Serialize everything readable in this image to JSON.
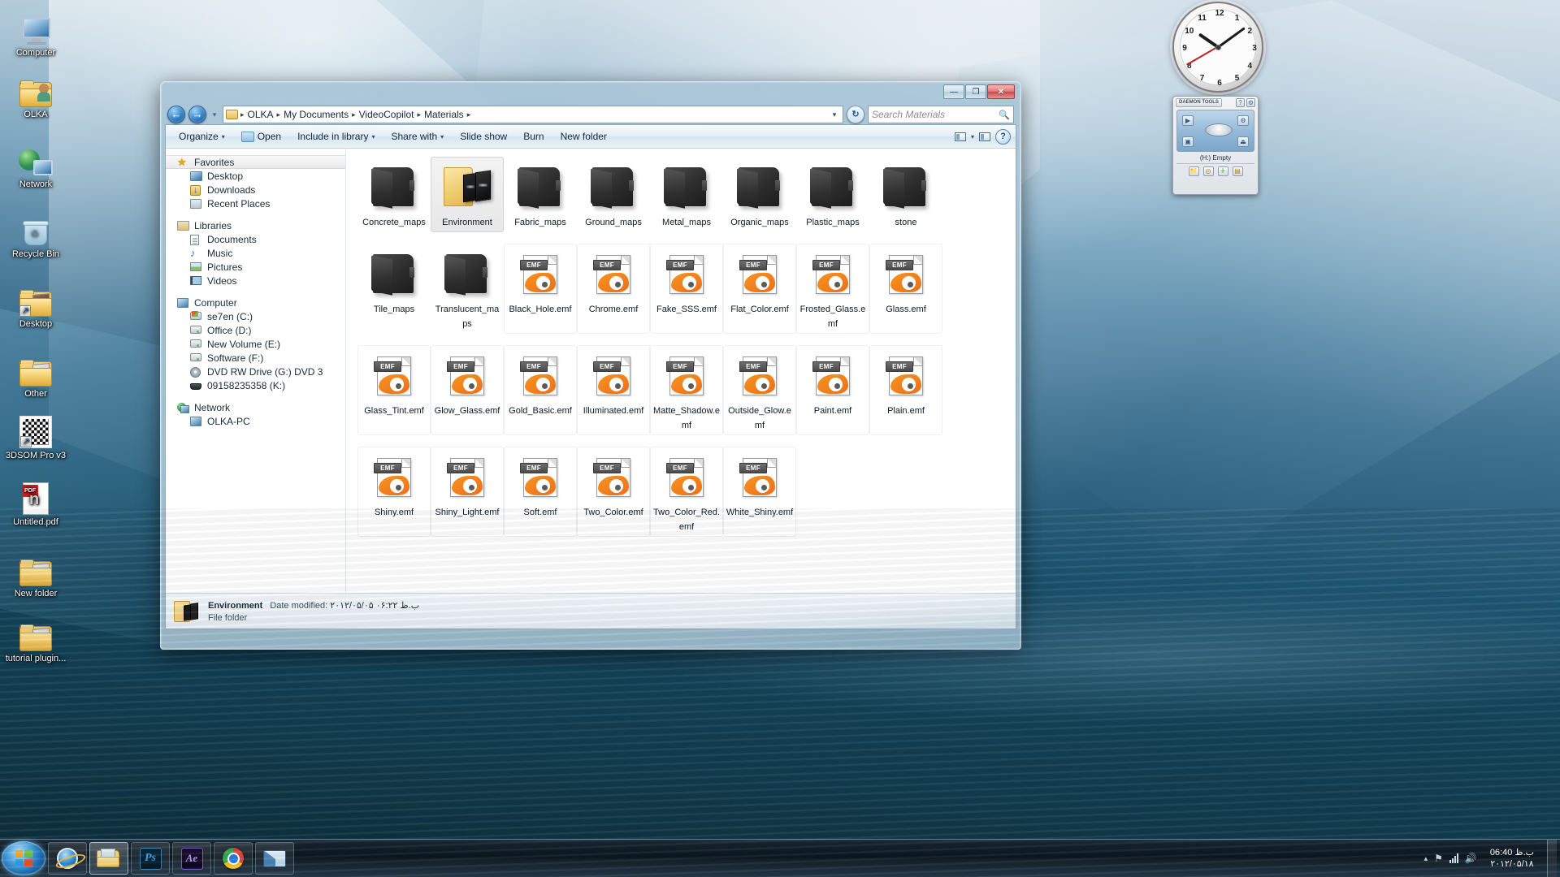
{
  "desktop": {
    "icons": [
      {
        "label": "Computer",
        "icon": "computer-icon"
      },
      {
        "label": "OLKA",
        "icon": "user-folder-icon"
      },
      {
        "label": "Network",
        "icon": "network-icon"
      },
      {
        "label": "Recycle Bin",
        "icon": "recycle-bin-icon"
      },
      {
        "label": "Desktop",
        "icon": "desktop-folder-shortcut-icon"
      },
      {
        "label": "Other",
        "icon": "folder-shortcut-icon"
      },
      {
        "label": "3DSOM Pro v3",
        "icon": "3dsom-shortcut-icon"
      },
      {
        "label": "Untitled.pdf",
        "icon": "pdf-file-icon"
      },
      {
        "label": "New folder",
        "icon": "folder-icon"
      },
      {
        "label": "tutorial plugin...",
        "icon": "folder-icon"
      }
    ]
  },
  "clock_gadget": {
    "name": "analog-clock",
    "hour": 10,
    "minute": 9,
    "second": 40,
    "numbers": [
      "12",
      "1",
      "2",
      "3",
      "4",
      "5",
      "6",
      "7",
      "8",
      "9",
      "10",
      "11"
    ]
  },
  "daemon_gadget": {
    "title": "DAEMON TOOLS",
    "help_label": "?",
    "options_label": "⚙",
    "drive_status": "(H:) Empty",
    "buttons": [
      "mount",
      "eject",
      "settings"
    ],
    "tray_buttons": [
      "📁",
      "💿",
      "＋",
      "🖫"
    ]
  },
  "window": {
    "controls": {
      "minimize": "—",
      "maximize": "❐",
      "close": "✕"
    },
    "nav": {
      "back": "←",
      "forward": "→",
      "history_caret": "▾"
    },
    "breadcrumb": {
      "items": [
        "OLKA",
        "My Documents",
        "VideoCopilot",
        "Materials"
      ],
      "separator": "▸",
      "dropdown": "▾",
      "refresh": "↻"
    },
    "search": {
      "placeholder": "Search Materials",
      "icon": "search-icon"
    },
    "commandbar": {
      "items": [
        {
          "label": "Organize",
          "caret": "▾",
          "icon": null
        },
        {
          "label": "Open",
          "caret": null,
          "icon": "open-folder-icon"
        },
        {
          "label": "Include in library",
          "caret": "▾",
          "icon": null
        },
        {
          "label": "Share with",
          "caret": "▾",
          "icon": null
        },
        {
          "label": "Slide show",
          "caret": null,
          "icon": null
        },
        {
          "label": "Burn",
          "caret": null,
          "icon": null
        },
        {
          "label": "New folder",
          "caret": null,
          "icon": null
        }
      ],
      "view_caret": "▾",
      "help_label": "?"
    },
    "navpane": {
      "groups": [
        {
          "header": {
            "label": "Favorites",
            "icon": "star-icon",
            "selected": true
          },
          "children": [
            {
              "label": "Desktop",
              "icon": "desktop-icon"
            },
            {
              "label": "Downloads",
              "icon": "downloads-icon"
            },
            {
              "label": "Recent Places",
              "icon": "recent-places-icon"
            }
          ]
        },
        {
          "header": {
            "label": "Libraries",
            "icon": "libraries-icon",
            "selected": false
          },
          "children": [
            {
              "label": "Documents",
              "icon": "document-icon"
            },
            {
              "label": "Music",
              "icon": "music-icon"
            },
            {
              "label": "Pictures",
              "icon": "pictures-icon"
            },
            {
              "label": "Videos",
              "icon": "videos-icon"
            }
          ]
        },
        {
          "header": {
            "label": "Computer",
            "icon": "computer-icon",
            "selected": false
          },
          "children": [
            {
              "label": "se7en (C:)",
              "icon": "system-drive-icon"
            },
            {
              "label": "Office (D:)",
              "icon": "drive-icon"
            },
            {
              "label": "New Volume (E:)",
              "icon": "drive-icon"
            },
            {
              "label": "Software (F:)",
              "icon": "drive-icon"
            },
            {
              "label": "DVD RW Drive (G:) DVD 3",
              "icon": "dvd-drive-icon"
            },
            {
              "label": "09158235358 (K:)",
              "icon": "portable-device-icon"
            }
          ]
        },
        {
          "header": {
            "label": "Network",
            "icon": "network-icon",
            "selected": false
          },
          "children": [
            {
              "label": "OLKA-PC",
              "icon": "computer-icon"
            }
          ]
        }
      ]
    },
    "files": [
      {
        "name": "Concrete_maps",
        "type": "folder-dark",
        "selected": false
      },
      {
        "name": "Environment",
        "type": "folder-thumb",
        "selected": true
      },
      {
        "name": "Fabric_maps",
        "type": "folder-dark",
        "selected": false
      },
      {
        "name": "Ground_maps",
        "type": "folder-dark",
        "selected": false
      },
      {
        "name": "Metal_maps",
        "type": "folder-dark",
        "selected": false
      },
      {
        "name": "Organic_maps",
        "type": "folder-dark",
        "selected": false
      },
      {
        "name": "Plastic_maps",
        "type": "folder-dark",
        "selected": false
      },
      {
        "name": "stone",
        "type": "folder-dark",
        "selected": false
      },
      {
        "name": "Tile_maps",
        "type": "folder-dark",
        "selected": false
      },
      {
        "name": "Translucent_maps",
        "type": "folder-dark",
        "selected": false
      },
      {
        "name": "Black_Hole.emf",
        "type": "emf",
        "selected": false
      },
      {
        "name": "Chrome.emf",
        "type": "emf",
        "selected": false
      },
      {
        "name": "Fake_SSS.emf",
        "type": "emf",
        "selected": false
      },
      {
        "name": "Flat_Color.emf",
        "type": "emf",
        "selected": false
      },
      {
        "name": "Frosted_Glass.emf",
        "type": "emf",
        "selected": false
      },
      {
        "name": "Glass.emf",
        "type": "emf",
        "selected": false
      },
      {
        "name": "Glass_Tint.emf",
        "type": "emf",
        "selected": false
      },
      {
        "name": "Glow_Glass.emf",
        "type": "emf",
        "selected": false
      },
      {
        "name": "Gold_Basic.emf",
        "type": "emf",
        "selected": false
      },
      {
        "name": "Illuminated.emf",
        "type": "emf",
        "selected": false
      },
      {
        "name": "Matte_Shadow.emf",
        "type": "emf",
        "selected": false
      },
      {
        "name": "Outside_Glow.emf",
        "type": "emf",
        "selected": false
      },
      {
        "name": "Paint.emf",
        "type": "emf",
        "selected": false
      },
      {
        "name": "Plain.emf",
        "type": "emf",
        "selected": false
      },
      {
        "name": "Shiny.emf",
        "type": "emf",
        "selected": false
      },
      {
        "name": "Shiny_Light.emf",
        "type": "emf",
        "selected": false
      },
      {
        "name": "Soft.emf",
        "type": "emf",
        "selected": false
      },
      {
        "name": "Two_Color.emf",
        "type": "emf",
        "selected": false
      },
      {
        "name": "Two_Color_Red.emf",
        "type": "emf",
        "selected": false
      },
      {
        "name": "White_Shiny.emf",
        "type": "emf",
        "selected": false
      }
    ],
    "emf_badge": "EMF",
    "statusbar": {
      "name": "Environment",
      "date_label": "Date modified:",
      "date_value": "۲۰۱۲/۰۵/۰۵ ب.ظ ۰۶:۲۲",
      "type": "File folder"
    }
  },
  "taskbar": {
    "start_label": "Start",
    "items": [
      {
        "name": "internet-explorer",
        "icon": "ie-icon",
        "active": false
      },
      {
        "name": "windows-explorer",
        "icon": "explorer-icon",
        "active": true
      },
      {
        "name": "photoshop",
        "icon": "photoshop-icon",
        "label": "Ps",
        "active": false
      },
      {
        "name": "after-effects",
        "icon": "after-effects-icon",
        "label": "Ae",
        "active": false
      },
      {
        "name": "chrome",
        "icon": "chrome-icon",
        "active": false
      },
      {
        "name": "mail",
        "icon": "mail-icon",
        "active": false
      }
    ],
    "tray": {
      "overflow_caret": "▴",
      "icons": [
        "flag-icon",
        "network-icon",
        "volume-icon"
      ],
      "time": "06:40 ب.ظ",
      "date": "۲۰۱۲/۰۵/۱۸"
    }
  }
}
